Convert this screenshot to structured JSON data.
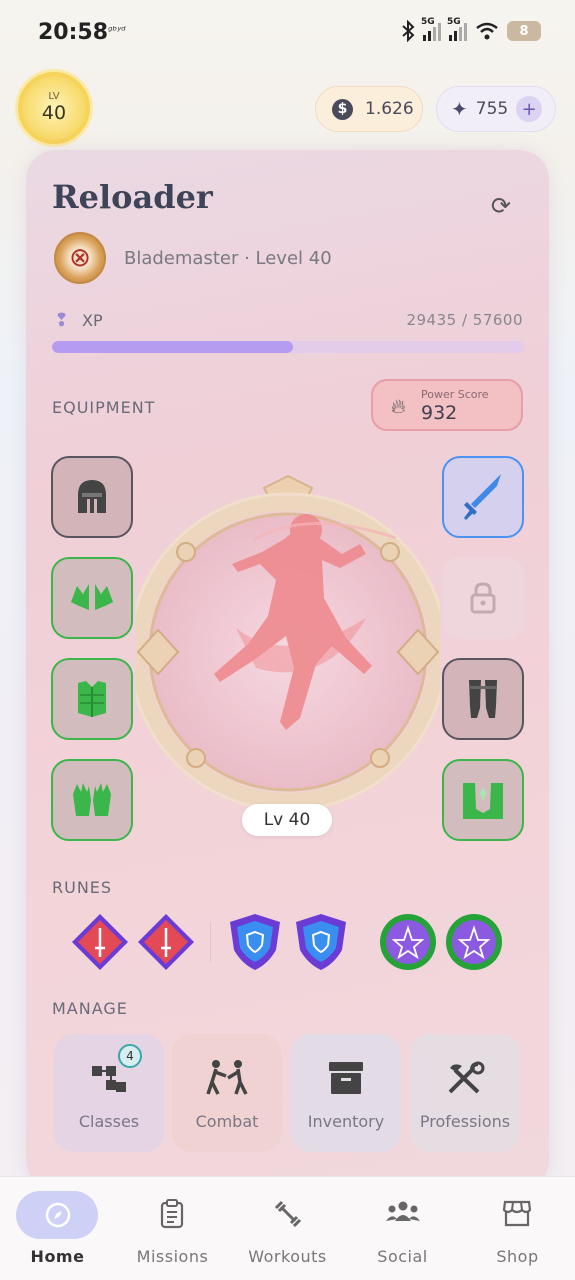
{
  "status_bar": {
    "time": "20:58",
    "note": "ᵍᵇʸᵈ",
    "network": "5G",
    "battery": "8"
  },
  "header": {
    "level_label": "LV",
    "level": "40",
    "coins": "1.626",
    "gems": "755",
    "add": "+"
  },
  "character": {
    "name": "Reloader",
    "class_line": "Blademaster · Level 40",
    "xp_label": "XP",
    "xp_value": "29435 / 57600",
    "xp_progress": 0.511,
    "portrait_level": "Lv 40"
  },
  "equipment": {
    "label": "EQUIPMENT",
    "power_label": "Power Score",
    "power_value": "932",
    "left_slots": [
      {
        "slot": "helmet",
        "icon": "helmet-icon",
        "state": "unequipped"
      },
      {
        "slot": "shoulders",
        "icon": "shoulders-icon",
        "state": "equipped"
      },
      {
        "slot": "chest",
        "icon": "chest-armor-icon",
        "state": "equipped"
      },
      {
        "slot": "gloves",
        "icon": "gloves-icon",
        "state": "equipped"
      }
    ],
    "right_slots": [
      {
        "slot": "weapon",
        "icon": "sword-icon",
        "state": "equipped-rare"
      },
      {
        "slot": "offhand",
        "icon": "lock-icon",
        "state": "locked"
      },
      {
        "slot": "legs",
        "icon": "leg-armor-icon",
        "state": "unequipped"
      },
      {
        "slot": "boots",
        "icon": "boots-icon",
        "state": "equipped"
      }
    ]
  },
  "runes": {
    "label": "RUNES",
    "items": [
      "sword-rune-icon",
      "sword-rune-icon",
      "shield-rune-icon",
      "shield-rune-icon",
      "star-rune-icon",
      "star-rune-icon"
    ]
  },
  "manage": {
    "label": "MANAGE",
    "tiles": [
      {
        "label": "Classes",
        "icon": "classes-icon",
        "badge": "4",
        "color": "#e5d4e4"
      },
      {
        "label": "Combat",
        "icon": "combat-icon",
        "color": "#f0d2d3"
      },
      {
        "label": "Inventory",
        "icon": "inventory-icon",
        "color": "#e3dbe6"
      },
      {
        "label": "Professions",
        "icon": "professions-icon",
        "color": "#e6dde3"
      }
    ]
  },
  "nav": {
    "items": [
      {
        "label": "Home",
        "icon": "compass-icon",
        "active": true
      },
      {
        "label": "Missions",
        "icon": "clipboard-icon"
      },
      {
        "label": "Workouts",
        "icon": "dumbbell-icon"
      },
      {
        "label": "Social",
        "icon": "people-icon"
      },
      {
        "label": "Shop",
        "icon": "store-icon"
      }
    ]
  },
  "colors": {
    "equipped": "#3bb64a",
    "rare": "#4c92f0",
    "xp_fill": "#b69cf0",
    "power_bg": "#f3c0c4"
  }
}
